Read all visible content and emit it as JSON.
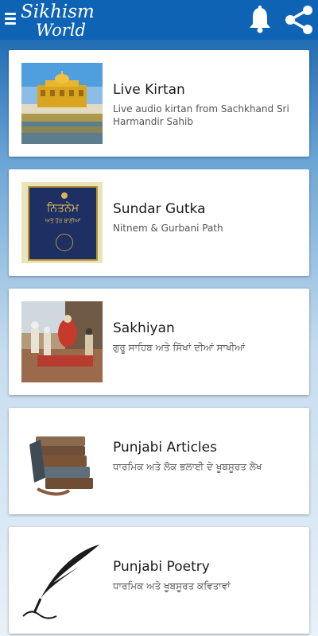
{
  "app": {
    "logo_line1": "Sikhism",
    "logo_line2": "World"
  },
  "icons": {
    "menu": "menu-icon",
    "bell": "bell-icon",
    "share": "share-icon"
  },
  "colors": {
    "appbar": "#0f63b4",
    "card": "#ffffff",
    "title": "#1b1b1b",
    "subtitle": "#555555"
  },
  "items": [
    {
      "title": "Live Kirtan",
      "subtitle": "Live audio kirtan from Sachkhand Sri Harmandir Sahib",
      "image": "golden-temple-image"
    },
    {
      "title": "Sundar Gutka",
      "subtitle": "Nitnem & Gurbani Path",
      "image": "gutka-book-image",
      "book_title": "ਨਿਤਨੇਮ",
      "book_sub": "ਅਤੇ ਹੋਰ ਬਾਣੀਆਂ"
    },
    {
      "title": "Sakhiyan",
      "subtitle": "ਗੁਰੂ ਸਾਹਿਬ ਅਤੇ ਸਿੱਖਾਂ ਦੀਆਂ ਸਾਖੀਆਂ",
      "image": "sakhi-painting-image"
    },
    {
      "title": "Punjabi Articles",
      "subtitle": "ਧਾਰਮਿਕ ਅਤੇ ਲੋਕ ਭਲਾਈ ਦੇ ਖੂਬਸੂਰਤ ਲੇਖ",
      "image": "book-stack-image"
    },
    {
      "title": "Punjabi Poetry",
      "subtitle": "ਧਾਰਮਿਕ ਅਤੇ ਖੂਬਸੂਰਤ ਕਵਿਤਾਵਾਂ",
      "image": "quill-pen-image"
    }
  ]
}
